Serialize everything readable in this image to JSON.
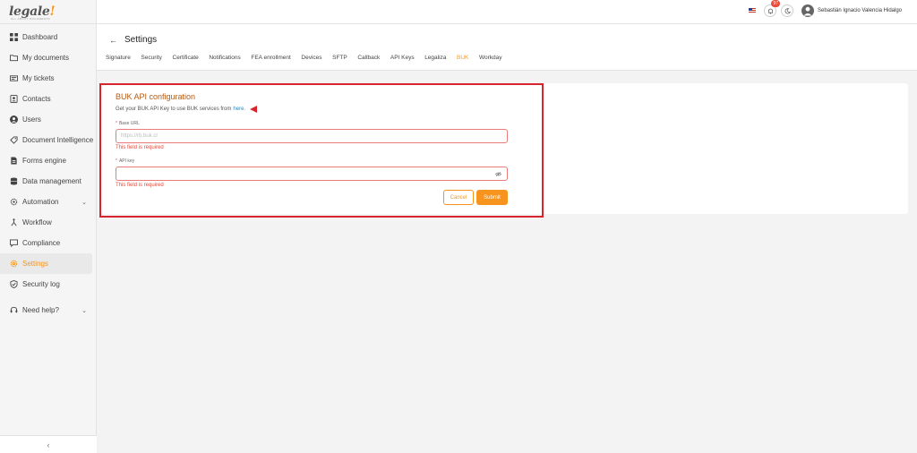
{
  "app": {
    "logo": "legale",
    "logo_mark": "!",
    "logo_sub": "ALL ABOUT DOCUMENTS"
  },
  "sidebar": {
    "items": [
      {
        "label": "Dashboard",
        "icon": "dashboard-icon"
      },
      {
        "label": "My documents",
        "icon": "folder-icon"
      },
      {
        "label": "My tickets",
        "icon": "ticket-icon"
      },
      {
        "label": "Contacts",
        "icon": "contacts-icon"
      },
      {
        "label": "Users",
        "icon": "user-icon"
      },
      {
        "label": "Document Intelligence",
        "icon": "tag-icon"
      },
      {
        "label": "Forms engine",
        "icon": "form-icon"
      },
      {
        "label": "Data management",
        "icon": "database-icon"
      },
      {
        "label": "Automation",
        "icon": "gear-icon"
      },
      {
        "label": "Workflow",
        "icon": "workflow-icon"
      },
      {
        "label": "Compliance",
        "icon": "chat-icon"
      },
      {
        "label": "Settings",
        "icon": "settings-icon",
        "active": true
      },
      {
        "label": "Security log",
        "icon": "shield-icon"
      },
      {
        "label": "Need help?",
        "icon": "headset-icon"
      }
    ],
    "collapse_label": "‹"
  },
  "topbar": {
    "notification_count": "97",
    "user_name": "Sebastián Ignacio Valencia Hidalgo"
  },
  "header": {
    "back_label": "←",
    "title": "Settings",
    "tabs": [
      {
        "label": "Signature"
      },
      {
        "label": "Security"
      },
      {
        "label": "Certificate"
      },
      {
        "label": "Notifications"
      },
      {
        "label": "FEA enrollment"
      },
      {
        "label": "Devices"
      },
      {
        "label": "SFTP"
      },
      {
        "label": "Callback"
      },
      {
        "label": "API Keys"
      },
      {
        "label": "Legaliza"
      },
      {
        "label": "BUK",
        "active": true
      },
      {
        "label": "Workday"
      }
    ]
  },
  "form": {
    "title": "BUK API configuration",
    "description": "Get your BUK API Key to use BUK services from",
    "link_text": "here.",
    "base_url_label": "Base URL",
    "base_url_placeholder": "https://rb.buk.cl",
    "base_url_value": "",
    "api_key_label": "API key",
    "api_key_value": "",
    "error_text": "This field is required",
    "cancel_label": "Cancel",
    "submit_label": "Submit"
  },
  "colors": {
    "accent": "#f7941d",
    "error": "#e74c3c",
    "highlight": "#d9232d",
    "link": "#1a8ac7"
  }
}
